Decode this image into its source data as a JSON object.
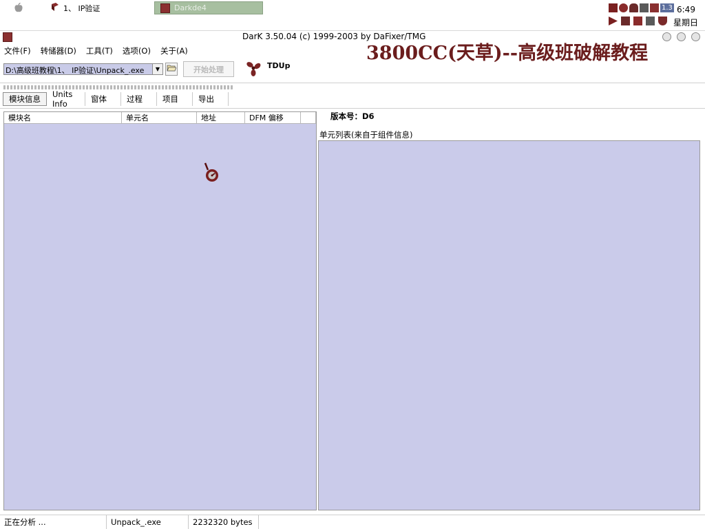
{
  "taskbar": {
    "task1_label": "1、 IP验证",
    "task2_label": "Darkde4",
    "tray_badge": "1.3",
    "clock_time": "6:49",
    "clock_day": "星期日"
  },
  "window": {
    "title": "DarK 3.50.04 (c) 1999-2003 by DaFixer/TMG"
  },
  "watermark": "3800CC(天草)--高级班破解教程",
  "menu": [
    "文件(F)",
    "转储器(D)",
    "工具(T)",
    "选项(O)",
    "关于(A)"
  ],
  "toolbar": {
    "path_value": "D:\\高级班教程\\1、 IP验证\\Unpack_.exe",
    "start_label": "开始处理",
    "tdup_label": "TDUp"
  },
  "tabs": [
    "模块信息",
    "Units Info",
    "窗体",
    "过程",
    "项目",
    "导出"
  ],
  "active_tab_index": 0,
  "list_columns": [
    "模块名",
    "单元名",
    "地址",
    "DFM 偏移",
    ""
  ],
  "version_label": "版本号：D6",
  "unit_list_label": "单元列表(来自于组件信息)",
  "status": {
    "state": "正在分析 ...",
    "file": "Unpack_.exe",
    "size": "2232320 bytes"
  },
  "colors": {
    "panel_bg": "#cacbea",
    "watermark": "#6b1d1d",
    "task_active": "#a7bfa0"
  }
}
